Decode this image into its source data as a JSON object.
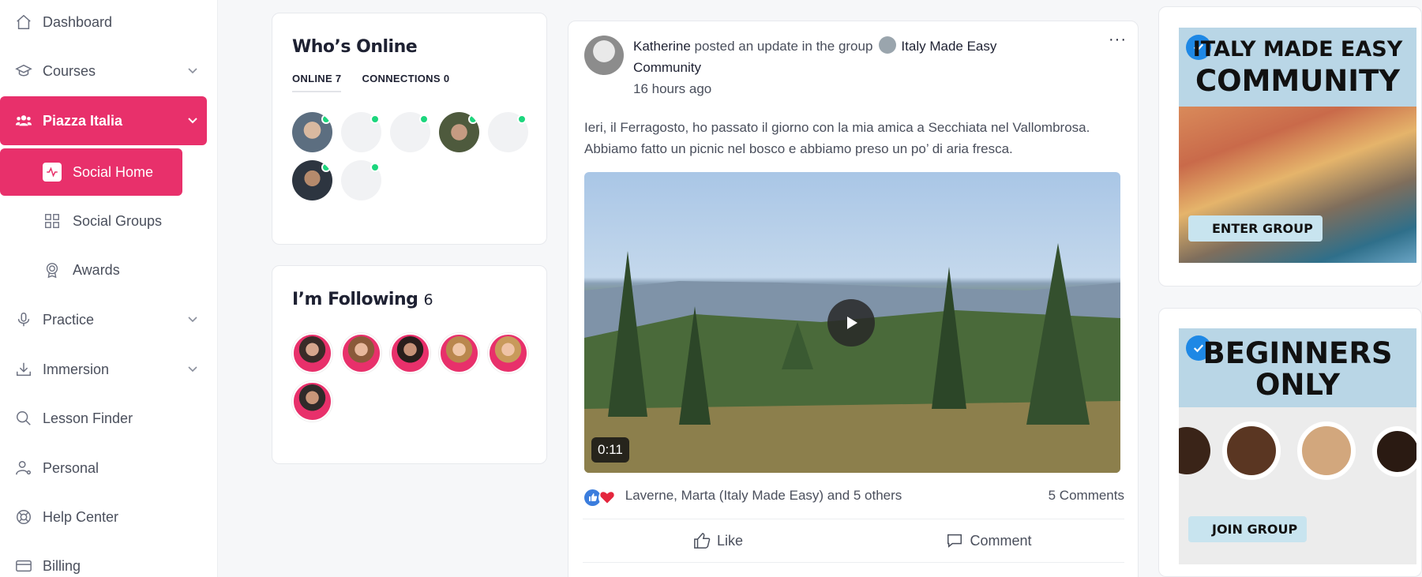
{
  "sidebar": {
    "items": [
      {
        "label": "Dashboard",
        "icon": "home-icon"
      },
      {
        "label": "Courses",
        "icon": "graduation-cap-icon"
      },
      {
        "label": "Piazza Italia",
        "icon": "users-icon"
      },
      {
        "label": "Practice",
        "icon": "microphone-icon"
      },
      {
        "label": "Immersion",
        "icon": "download-icon"
      },
      {
        "label": "Lesson Finder",
        "icon": "search-icon"
      },
      {
        "label": "Personal",
        "icon": "user-settings-icon"
      },
      {
        "label": "Help Center",
        "icon": "lifebuoy-icon"
      },
      {
        "label": "Billing",
        "icon": "credit-card-icon"
      }
    ],
    "subitems": [
      {
        "label": "Social Home",
        "icon": "activity-icon"
      },
      {
        "label": "Social Groups",
        "icon": "grid-icon"
      },
      {
        "label": "Awards",
        "icon": "award-icon"
      }
    ],
    "accent": "#e8306b"
  },
  "whos_online": {
    "title": "Who’s Online",
    "tabs": [
      {
        "label": "ONLINE",
        "count": "7"
      },
      {
        "label": "CONNECTIONS",
        "count": "0"
      }
    ]
  },
  "following": {
    "title": "I’m Following",
    "count": "6"
  },
  "post": {
    "author": "Katherine",
    "action": "posted an update in the group",
    "group": "Italy Made Easy",
    "group_line2": "Community",
    "time": "16 hours ago",
    "body_line1": "Ieri, il Ferragosto, ho passato il giorno con la mia amica a Secchiata nel Vallombrosa.",
    "body_line2": "Abbiamo fatto un picnic nel bosco e abbiamo preso un po’ di aria fresca.",
    "video_duration": "0:11",
    "reactions_text": "Laverne, Marta (Italy Made Easy) and 5 others",
    "comments_count": "5 Comments",
    "like_label": "Like",
    "comment_label": "Comment",
    "more_label": "···"
  },
  "promos": [
    {
      "line1": "ITALY MADE EASY",
      "line2": "COMMUNITY",
      "cta": "ENTER GROUP"
    },
    {
      "line1": "BEGINNERS",
      "line2": "ONLY",
      "cta": "JOIN GROUP"
    }
  ]
}
